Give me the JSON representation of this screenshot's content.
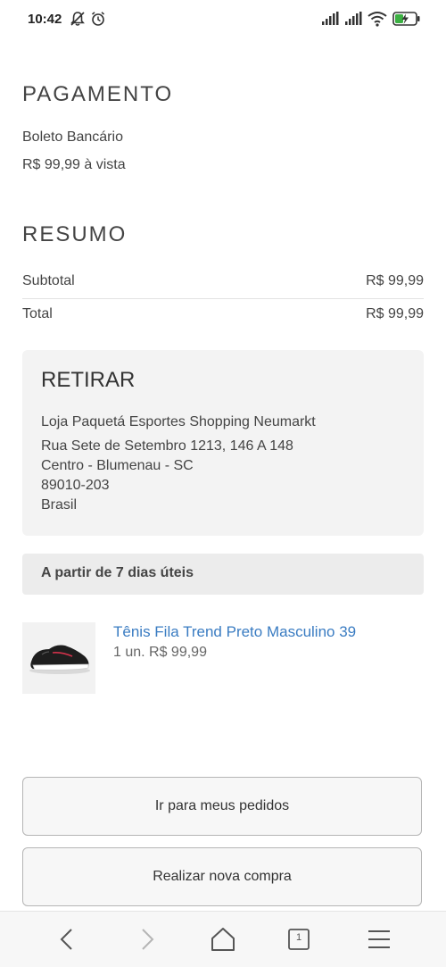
{
  "status_bar": {
    "time": "10:42"
  },
  "payment": {
    "title": "PAGAMENTO",
    "method": "Boleto Bancário",
    "amount": "R$ 99,99 à vista"
  },
  "summary": {
    "title": "RESUMO",
    "rows": [
      {
        "label": "Subtotal",
        "value": "R$ 99,99"
      },
      {
        "label": "Total",
        "value": "R$ 99,99"
      }
    ]
  },
  "pickup": {
    "title": "RETIRAR",
    "address_lines": [
      "Loja Paquetá Esportes Shopping Neumarkt",
      "Rua Sete de Setembro 1213, 146 A 148",
      "Centro - Blumenau - SC",
      "89010-203",
      "Brasil"
    ]
  },
  "delivery": {
    "label": "A partir de 7 dias úteis"
  },
  "product": {
    "name": "Tênis Fila Trend Preto Masculino 39",
    "qty_price": "1 un. R$ 99,99"
  },
  "actions": {
    "orders_label": "Ir para meus pedidos",
    "new_purchase_label": "Realizar nova compra"
  },
  "nav": {
    "tab_count": "1"
  }
}
